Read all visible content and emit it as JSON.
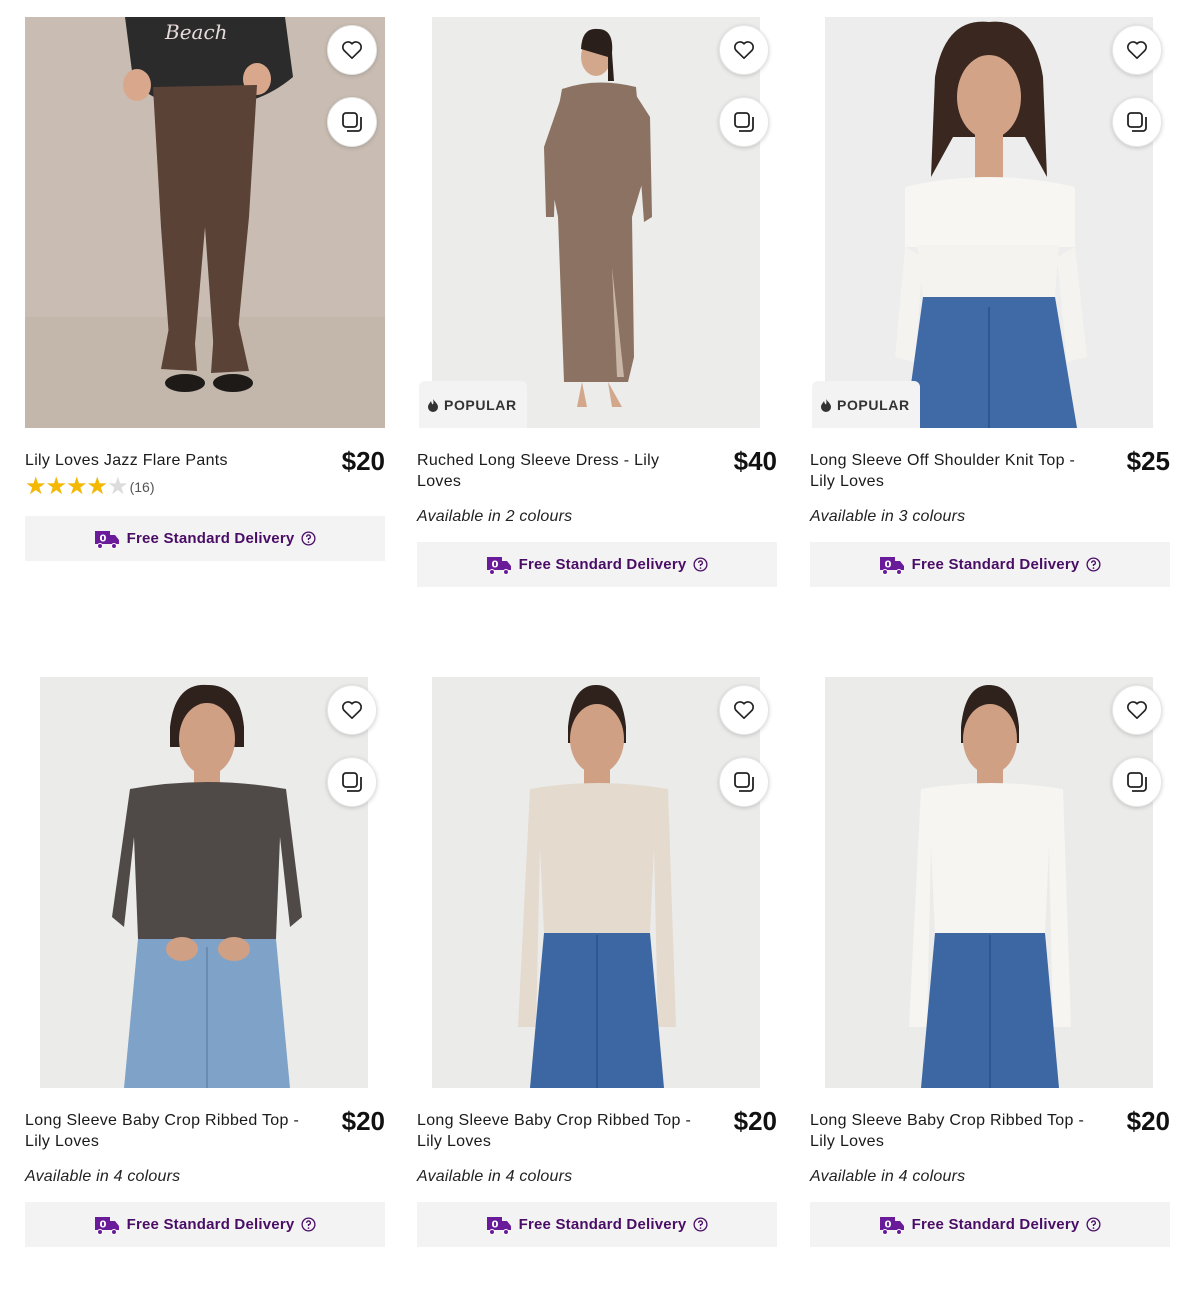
{
  "products": [
    {
      "title": "Lily Loves Jazz Flare Pants",
      "price": "$20",
      "rating": {
        "value": 4,
        "count": "(16)"
      },
      "availability": "",
      "badge": "",
      "delivery": "Free Standard Delivery",
      "image": "flare-pants"
    },
    {
      "title": "Ruched Long Sleeve Dress - Lily Loves",
      "price": "$40",
      "availability": "Available in 2 colours",
      "badge": "POPULAR",
      "delivery": "Free Standard Delivery",
      "image": "long-dress"
    },
    {
      "title": "Long Sleeve Off Shoulder Knit Top - Lily Loves",
      "price": "$25",
      "availability": "Available in 3 colours",
      "badge": "POPULAR",
      "delivery": "Free Standard Delivery",
      "image": "off-shoulder-top"
    },
    {
      "title": "Long Sleeve Baby Crop Ribbed Top - Lily Loves",
      "price": "$20",
      "availability": "Available in 4 colours",
      "badge": "",
      "delivery": "Free Standard Delivery",
      "image": "crop-top-charcoal"
    },
    {
      "title": "Long Sleeve Baby Crop Ribbed Top - Lily Loves",
      "price": "$20",
      "availability": "Available in 4 colours",
      "badge": "",
      "delivery": "Free Standard Delivery",
      "image": "crop-top-oatmeal"
    },
    {
      "title": "Long Sleeve Baby Crop Ribbed Top - Lily Loves",
      "price": "$20",
      "availability": "Available in 4 colours",
      "badge": "",
      "delivery": "Free Standard Delivery",
      "image": "crop-top-white"
    }
  ],
  "icons": {
    "wishlist": "heart-icon",
    "compare": "copy-icon",
    "badge": "flame-icon",
    "delivery": "delivery-truck-icon",
    "help": "help-circle-icon"
  },
  "colors": {
    "delivery_text": "#4a0d66",
    "delivery_bg": "#f3f3f3",
    "star": "#f5b800"
  }
}
